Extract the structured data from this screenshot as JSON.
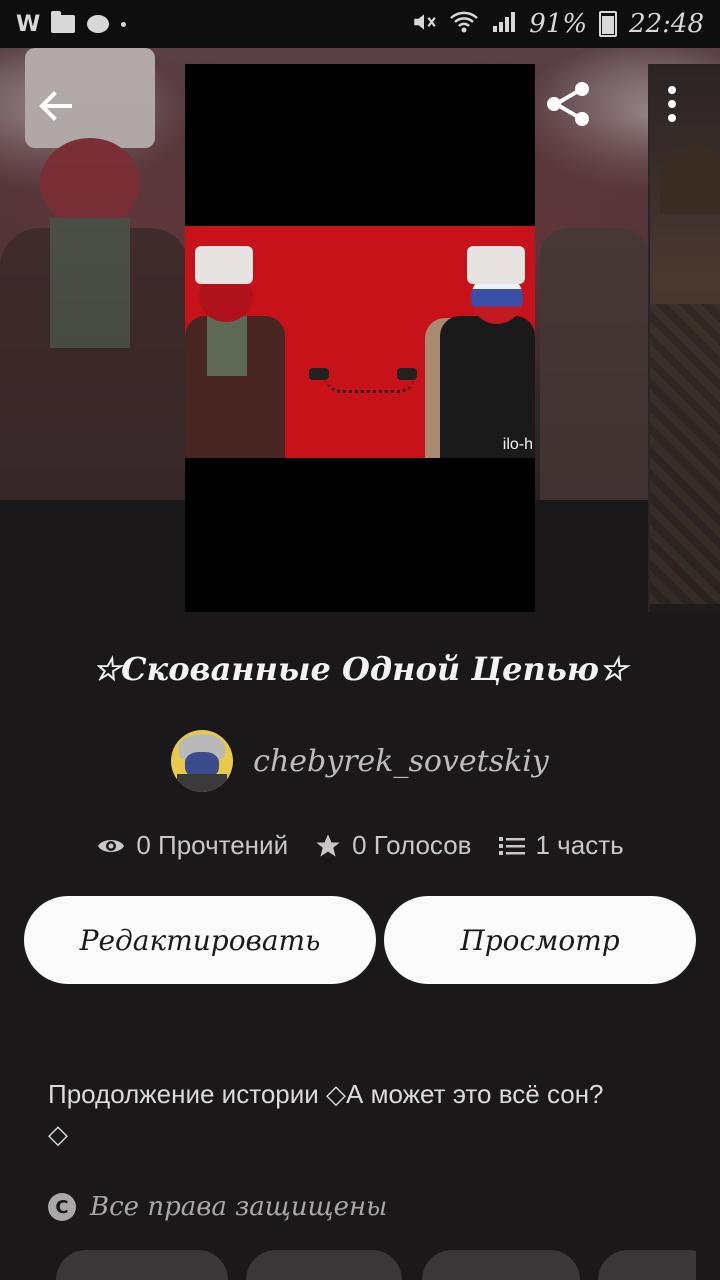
{
  "status_bar": {
    "app_icon": "W",
    "battery_percent": "91%",
    "time": "22:48"
  },
  "story": {
    "title": "☆Скованные Одной Цепью☆",
    "author": "chebyrek_sovetskiy",
    "cover_watermark": "ilo-h",
    "reads_label": "0 Прочтений",
    "votes_label": "0 Голосов",
    "parts_label": "1 часть",
    "edit_button": "Редактировать",
    "view_button": "Просмотр",
    "description_line1": "Продолжение истории  ◇А может это всё сон?",
    "description_line2": "◇",
    "copyright": "Все права защищены"
  },
  "icons": {
    "back": "arrow-left-icon",
    "share": "share-icon",
    "more": "more-vertical-icon",
    "reads": "eye-icon",
    "votes": "star-icon",
    "parts": "list-icon",
    "copyright": "copyright-icon"
  },
  "colors": {
    "background": "#1a1819",
    "button_bg": "#fbfbfb",
    "cover_red": "#c8121a"
  }
}
